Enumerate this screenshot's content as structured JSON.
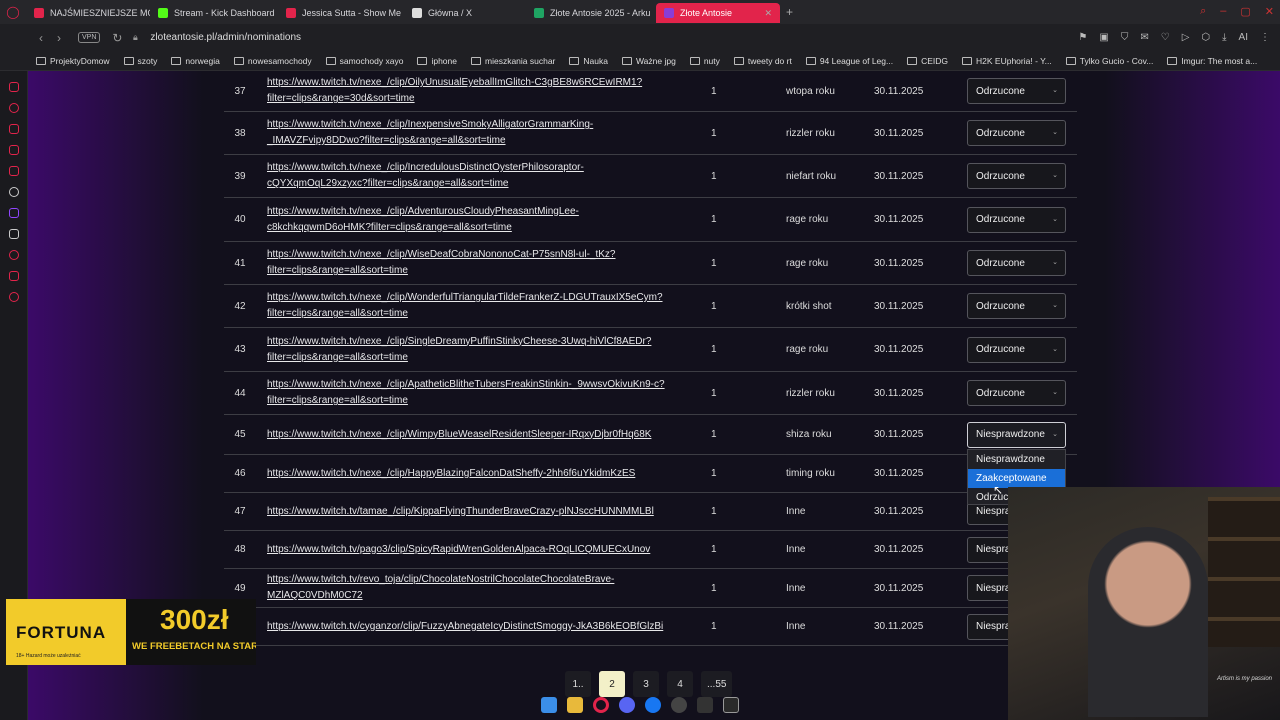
{
  "tabs": [
    {
      "title": "NAJŚMIESZNIEJSZE MOM",
      "color": "#e2244b"
    },
    {
      "title": "Stream - Kick Dashboard",
      "color": "#53fc18"
    },
    {
      "title": "Jessica Sutta - Show Me",
      "color": "#e2244b"
    },
    {
      "title": "Główna / X",
      "color": "#dddddd"
    },
    {
      "title": "Złote Antosie 2025 - Arku",
      "color": "#1fa463"
    },
    {
      "title": "Złote Antosie",
      "color": "#8a3dd6"
    }
  ],
  "address": {
    "vpn": "VPN",
    "url": "zloteantosie.pl/admin/nominations"
  },
  "bookmarks": [
    "ProjektyDomow",
    "szoty",
    "norwegia",
    "nowesamochody",
    "samochody xayo",
    "iphone",
    "mieszkania suchar",
    "Nauka",
    "Ważne jpg",
    "nuty",
    "tweety do rt",
    "94 League of Leg...",
    "CEIDG",
    "H2K EUphoria! - Y...",
    "Tylko Gucio - Cov...",
    "Imgur: The most a..."
  ],
  "rows": [
    {
      "n": "37",
      "line1": "https://www.twitch.tv/nexe_/clip/OilyUnusualEyeballImGlitch-C3gBE8w6RCEwIRM1?",
      "line2": "filter=clips&range=30d&sort=time",
      "count": "1",
      "category": "wtopa roku",
      "date": "30.11.2025",
      "status": "Odrzucone"
    },
    {
      "n": "38",
      "line1": "https://www.twitch.tv/nexe_/clip/InexpensiveSmokyAlligatorGrammarKing-",
      "line2": "_IMAVZFvipy8DDwo?filter=clips&range=all&sort=time",
      "count": "1",
      "category": "rizzler roku",
      "date": "30.11.2025",
      "status": "Odrzucone"
    },
    {
      "n": "39",
      "line1": "https://www.twitch.tv/nexe_/clip/IncredulousDistinctOysterPhilosoraptor-",
      "line2": "cQYXqmOqL29xzyxc?filter=clips&range=all&sort=time",
      "count": "1",
      "category": "niefart roku",
      "date": "30.11.2025",
      "status": "Odrzucone"
    },
    {
      "n": "40",
      "line1": "https://www.twitch.tv/nexe_/clip/AdventurousCloudyPheasantMingLee-",
      "line2": "c8kchkqqwmD6oHMK?filter=clips&range=all&sort=time",
      "count": "1",
      "category": "rage roku",
      "date": "30.11.2025",
      "status": "Odrzucone"
    },
    {
      "n": "41",
      "line1": "https://www.twitch.tv/nexe_/clip/WiseDeafCobraNononoCat-P75snN8l-ul-_tKz?",
      "line2": "filter=clips&range=all&sort=time",
      "count": "1",
      "category": "rage roku",
      "date": "30.11.2025",
      "status": "Odrzucone"
    },
    {
      "n": "42",
      "line1": "https://www.twitch.tv/nexe_/clip/WonderfulTriangularTildeFrankerZ-LDGUTrauxIX5eCym?",
      "line2": "filter=clips&range=all&sort=time",
      "count": "1",
      "category": "krótki shot",
      "date": "30.11.2025",
      "status": "Odrzucone"
    },
    {
      "n": "43",
      "line1": "https://www.twitch.tv/nexe_/clip/SingleDreamyPuffinStinkyCheese-3Uwq-hiVlCf8AEDr?",
      "line2": "filter=clips&range=all&sort=time",
      "count": "1",
      "category": "rage roku",
      "date": "30.11.2025",
      "status": "Odrzucone"
    },
    {
      "n": "44",
      "line1": "https://www.twitch.tv/nexe_/clip/ApatheticBlitheTubersFreakinStinkin-_9wwsvOkivuKn9-c?",
      "line2": "filter=clips&range=all&sort=time",
      "count": "1",
      "category": "rizzler roku",
      "date": "30.11.2025",
      "status": "Odrzucone"
    },
    {
      "n": "45",
      "line1": "https://www.twitch.tv/nexe_/clip/WimpyBlueWeaselResidentSleeper-IRqxyDjbr0fHq68K",
      "line2": "",
      "count": "1",
      "category": "shiza roku",
      "date": "30.11.2025",
      "status": "Niesprawdzone"
    },
    {
      "n": "46",
      "line1": "https://www.twitch.tv/nexe_/clip/HappyBlazingFalconDatSheffy-2hh6f6uYkidmKzES",
      "line2": "",
      "count": "1",
      "category": "timing roku",
      "date": "30.11.2025",
      "status": ""
    },
    {
      "n": "47",
      "line1": "https://www.twitch.tv/tamae_/clip/KippaFlyingThunderBraveCrazy-plNJsccHUNNMMLBl",
      "line2": "",
      "count": "1",
      "category": "Inne",
      "date": "30.11.2025",
      "status": "Niespra"
    },
    {
      "n": "48",
      "line1": "https://www.twitch.tv/pago3/clip/SpicyRapidWrenGoldenAlpaca-ROqLICQMUECxUnov",
      "line2": "",
      "count": "1",
      "category": "Inne",
      "date": "30.11.2025",
      "status": "Niespra"
    },
    {
      "n": "49",
      "line1": "https://www.twitch.tv/revo_toja/clip/ChocolateNostrilChocolateChocolateBrave-",
      "line2": "MZlAQC0VDhM0C72",
      "count": "1",
      "category": "Inne",
      "date": "30.11.2025",
      "status": "Niespra"
    },
    {
      "n": "50",
      "line1": "https://www.twitch.tv/cyganzor/clip/FuzzyAbnegateIcyDistinctSmoggy-JkA3B6kEOBfGlzBi",
      "line2": "",
      "count": "1",
      "category": "Inne",
      "date": "30.11.2025",
      "status": "Niespra"
    }
  ],
  "dropdown": {
    "options": [
      "Niesprawdzone",
      "Zaakceptowane",
      "Odrzuc"
    ],
    "highlighted": 1
  },
  "pager": [
    "1..",
    "2",
    "3",
    "4",
    "...55"
  ],
  "ad": {
    "brand": "FORTUNA",
    "amount": "300zł",
    "text": "WE FREEBETACH NA START",
    "fine": "18+ Hazard może uzależniać"
  },
  "webcam": {
    "caption": "Artism is my passion"
  },
  "colors": {
    "accent": "#e2244b",
    "highlight": "#1a6fd8",
    "active_page": "#f3f0c8"
  }
}
